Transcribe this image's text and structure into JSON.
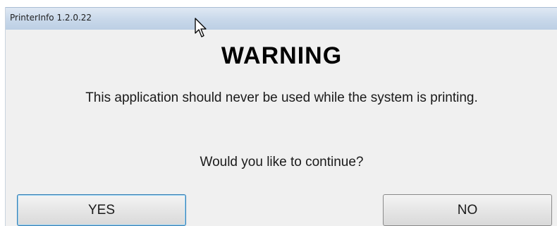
{
  "window": {
    "title": "PrinterInfo 1.2.0.22"
  },
  "dialog": {
    "heading": "WARNING",
    "message": "This application should never be used while the system is printing.",
    "question": "Would you like to continue?"
  },
  "buttons": {
    "yes_label": "YES",
    "no_label": "NO"
  },
  "icons": {
    "cursor": "mouse-pointer-icon"
  },
  "colors": {
    "titlebar": "#c8d8ea",
    "background": "#f0f0f0",
    "focus_border": "#3c7fb1"
  }
}
